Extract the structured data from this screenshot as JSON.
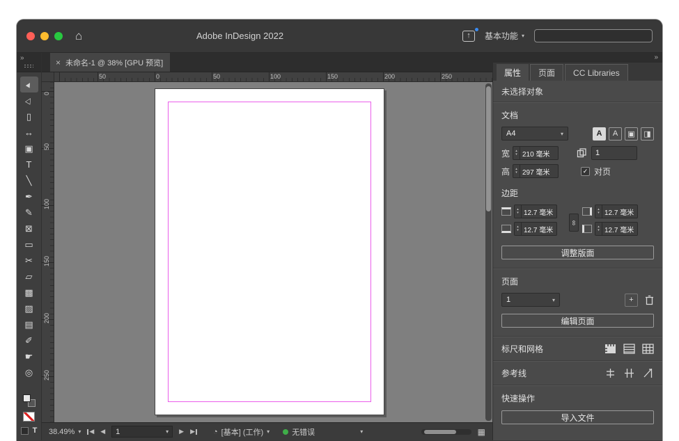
{
  "icons": {
    "close": "×",
    "home": "⌂",
    "share": "↑",
    "chev": "▾",
    "dchev": "»",
    "up": "▴",
    "down": "▾",
    "check": "✓",
    "plus": "+",
    "preflight": "◔",
    "dot": "●",
    "grid": "▦",
    "link": "∞",
    "prev": "◀",
    "next": "▶"
  },
  "colors": {
    "traffic_red": "#ff5f57",
    "traffic_yellow": "#febc2e",
    "traffic_green": "#28c840",
    "status_ok_green": "#3fae49",
    "margin_guide_magenta": "#ea5dea"
  },
  "titlebar": {
    "title": "Adobe InDesign 2022",
    "workspace": "基本功能",
    "search_value": ""
  },
  "doc_tab": {
    "label": "未命名-1 @ 38% [GPU 预览]"
  },
  "toolbar": {
    "tools": [
      {
        "name": "selection-tool",
        "glyph": "►"
      },
      {
        "name": "direct-selection-tool",
        "glyph": "▷"
      },
      {
        "name": "page-tool",
        "glyph": "▯"
      },
      {
        "name": "gap-tool",
        "glyph": "↔"
      },
      {
        "name": "content-collector-tool",
        "glyph": "▣"
      },
      {
        "name": "type-tool",
        "glyph": "T"
      },
      {
        "name": "line-tool",
        "glyph": "╲"
      },
      {
        "name": "pen-tool",
        "glyph": "✒"
      },
      {
        "name": "pencil-tool",
        "glyph": "✎"
      },
      {
        "name": "rectangle-frame-tool",
        "glyph": "⊠"
      },
      {
        "name": "rectangle-tool",
        "glyph": "▭"
      },
      {
        "name": "scissors-tool",
        "glyph": "✂"
      },
      {
        "name": "free-transform-tool",
        "glyph": "▱"
      },
      {
        "name": "gradient-swatch-tool",
        "glyph": "▩"
      },
      {
        "name": "gradient-feather-tool",
        "glyph": "▨"
      },
      {
        "name": "note-tool",
        "glyph": "▤"
      },
      {
        "name": "color-theme-tool",
        "glyph": "✐"
      },
      {
        "name": "hand-tool",
        "glyph": "☛"
      },
      {
        "name": "zoom-tool",
        "glyph": "◎"
      }
    ]
  },
  "rulers": {
    "h": [
      "50",
      "0",
      "50",
      "100",
      "150",
      "200",
      "250"
    ],
    "v": [
      "0",
      "50",
      "100",
      "150",
      "200",
      "250"
    ]
  },
  "panel": {
    "tabs": [
      "属性",
      "页面",
      "CC Libraries"
    ],
    "no_selection": "未选择对象",
    "document": {
      "label": "文档",
      "preset": "A4",
      "width_label": "宽",
      "width": "210 毫米",
      "height_label": "高",
      "height": "297 毫米",
      "page_count": "1",
      "facing_pages": "对页"
    },
    "margins": {
      "label": "边距",
      "top": "12.7 毫米",
      "bottom": "12.7 毫米",
      "left": "12.7 毫米",
      "right": "12.7 毫米"
    },
    "adjust_layout": "调整版面",
    "pages": {
      "label": "页面",
      "current": "1",
      "edit": "编辑页面"
    },
    "rulers_grids": "标尺和网格",
    "guides": "参考线",
    "quick": {
      "label": "快速操作",
      "import": "导入文件"
    }
  },
  "statusbar": {
    "zoom": "38.49%",
    "page": "1",
    "preflight_profile": "[基本] (工作)",
    "errors": "无错误"
  }
}
